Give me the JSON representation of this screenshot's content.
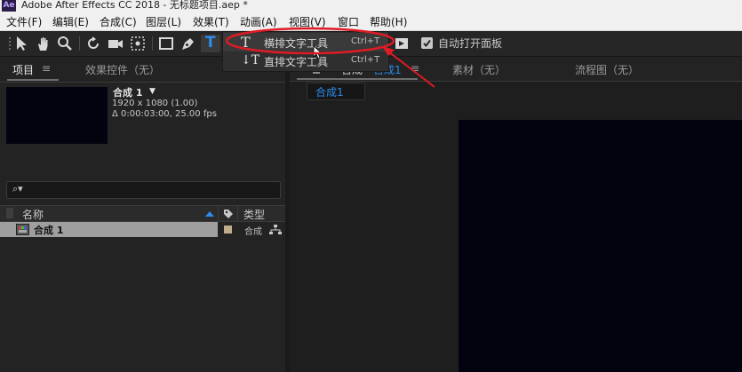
{
  "window": {
    "logo": "Ae",
    "title": "Adobe After Effects CC 2018 - 无标题项目.aep *"
  },
  "menu": [
    "文件(F)",
    "编辑(E)",
    "合成(C)",
    "图层(L)",
    "效果(T)",
    "动画(A)",
    "视图(V)",
    "窗口",
    "帮助(H)"
  ],
  "toolbar": {
    "auto_open_label": "自动打开面板",
    "auto_open_checked": true,
    "text_tool_glyph": "T"
  },
  "text_tool_menu": [
    {
      "glyph": "T",
      "label": "横排文字工具",
      "shortcut": "Ctrl+T"
    },
    {
      "glyph": "↓T",
      "label": "直排文字工具",
      "shortcut": "Ctrl+T"
    }
  ],
  "project_panel": {
    "tabs": [
      "项目",
      "效果控件（无）"
    ],
    "tab_menu_icon": "≡",
    "comp_name": "合成 1",
    "comp_arrow": "▼",
    "comp_size": "1920 x 1080 (1.00)",
    "comp_duration": "Δ 0:00:03:00, 25.00 fps",
    "search_icon_glyph": "⌕▾",
    "columns": {
      "name": "名称",
      "type": "类型"
    },
    "rows": [
      {
        "name": "合成 1",
        "type": "合成"
      }
    ]
  },
  "viewer": {
    "tabs": [
      "合成 合成1",
      "素材（无）",
      "流程图（无）"
    ],
    "comp_tab_prefix": "合成",
    "comp_tab_name": "合成1",
    "sub_tab": "合成1",
    "tab_menu_icon": "≡"
  },
  "colors": {
    "annotation_red": "#e01b24",
    "active_blue": "#2d8ceb",
    "comp_canvas": "#03030f"
  }
}
